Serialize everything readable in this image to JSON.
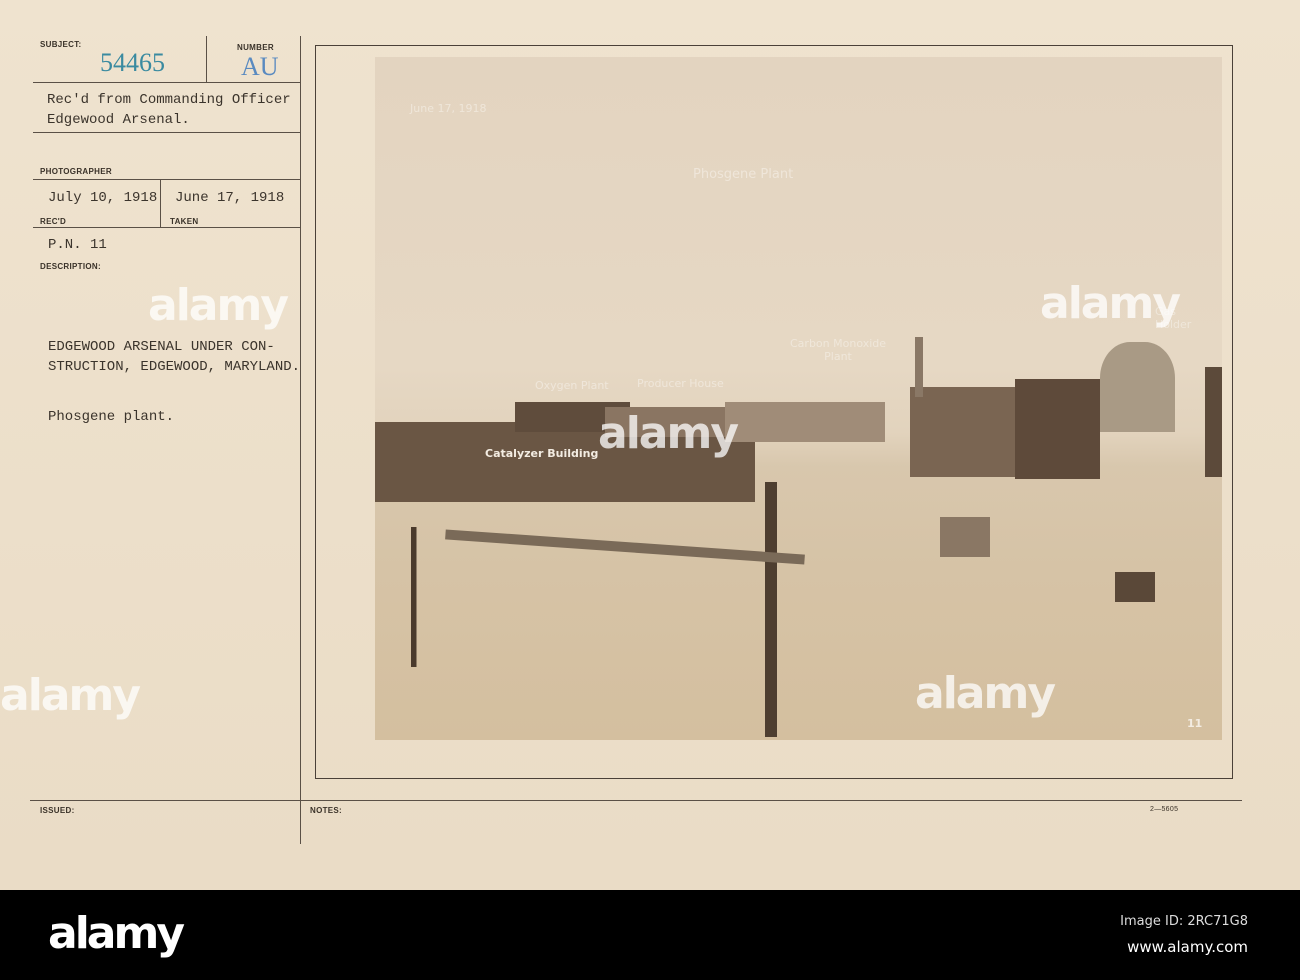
{
  "card": {
    "subject_label": "SUBJECT:",
    "subject_number": "54465",
    "number_label": "NUMBER",
    "number_value": "AU",
    "received_from": "Rec'd from Commanding Officer",
    "received_from_line2": "Edgewood Arsenal.",
    "photographer_label": "PHOTOGRAPHER",
    "recd_date": "July 10, 1918",
    "taken_date": "June 17, 1918",
    "recd_label": "REC'D",
    "taken_label": "TAKEN",
    "pn": "P.N. 11",
    "description_label": "DESCRIPTION:",
    "description_line1": "EDGEWOOD ARSENAL UNDER CON-",
    "description_line2": "STRUCTION, EDGEWOOD, MARYLAND.",
    "description_line3": "Phosgene plant.",
    "issued_label": "ISSUED:",
    "notes_label": "NOTES:",
    "form_number": "2—5605"
  },
  "photo": {
    "date_annotation": "June 17, 1918",
    "title_annotation": "Phosgene Plant",
    "catalyzer_label": "Catalyzer Building",
    "oxygen_label": "Oxygen Plant",
    "producer_label": "Producer House",
    "carbon_label": "Carbon Monoxide\nPlant",
    "gas_label": "Gas\nHolder",
    "plate_number": "11"
  },
  "watermark": "alamy",
  "footer": {
    "logo": "alamy",
    "image_id": "Image ID: 2RC71G8",
    "url": "www.alamy.com"
  }
}
